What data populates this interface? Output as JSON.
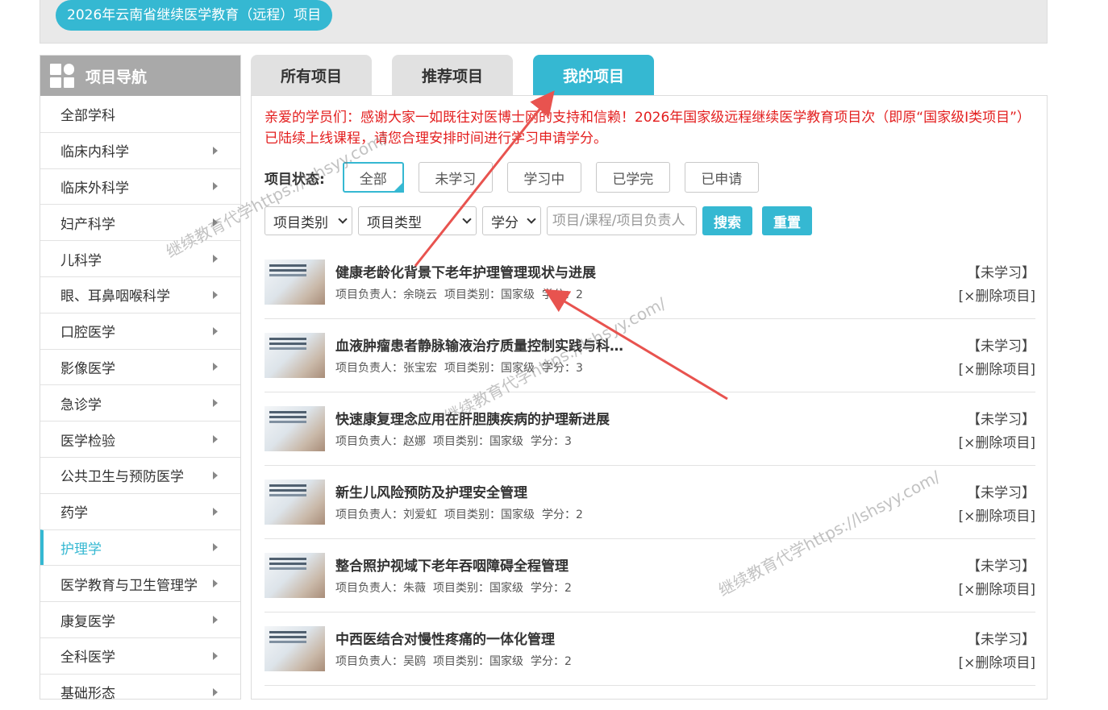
{
  "header": {
    "title": "2026年云南省继续医学教育（远程）项目"
  },
  "sidebar": {
    "title": "项目导航",
    "items": [
      {
        "label": "全部学科",
        "arrow": false
      },
      {
        "label": "临床内科学",
        "arrow": true
      },
      {
        "label": "临床外科学",
        "arrow": true
      },
      {
        "label": "妇产科学",
        "arrow": true
      },
      {
        "label": "儿科学",
        "arrow": true
      },
      {
        "label": "眼、耳鼻咽喉科学",
        "arrow": true
      },
      {
        "label": "口腔医学",
        "arrow": true
      },
      {
        "label": "影像医学",
        "arrow": true
      },
      {
        "label": "急诊学",
        "arrow": true
      },
      {
        "label": "医学检验",
        "arrow": true
      },
      {
        "label": "公共卫生与预防医学",
        "arrow": true
      },
      {
        "label": "药学",
        "arrow": true
      },
      {
        "label": "护理学",
        "arrow": true,
        "active": true
      },
      {
        "label": "医学教育与卫生管理学",
        "arrow": true
      },
      {
        "label": "康复医学",
        "arrow": true
      },
      {
        "label": "全科医学",
        "arrow": true
      },
      {
        "label": "基础形态",
        "arrow": true
      }
    ]
  },
  "tabs": [
    {
      "label": "所有项目"
    },
    {
      "label": "推荐项目"
    },
    {
      "label": "我的项目",
      "active": true
    }
  ],
  "notice": "亲爱的学员们：感谢大家一如既往对医博士网的支持和信赖！2026年国家级远程继续医学教育项目次（即原“国家级Ⅰ类项目”）已陆续上线课程，请您合理安排时间进行学习申请学分。",
  "status_filter": {
    "label": "项目状态:",
    "options": [
      "全部",
      "未学习",
      "学习中",
      "已学完",
      "已申请"
    ],
    "selected": 0
  },
  "filters": {
    "category": "项目类别",
    "type": "项目类型",
    "credit": "学分",
    "search_placeholder": "项目/课程/项目负责人",
    "search_btn": "搜索",
    "reset_btn": "重置"
  },
  "meta_labels": {
    "leader": "项目负责人：",
    "category": "项目类别：",
    "credit": "学分："
  },
  "projects": [
    {
      "title": "健康老龄化背景下老年护理管理现状与进展",
      "leader": "余晓云",
      "category": "国家级",
      "credit": "2",
      "status": "【未学习】",
      "delete": "[×删除项目]"
    },
    {
      "title": "血液肿瘤患者静脉输液治疗质量控制实践与科…",
      "leader": "张宝宏",
      "category": "国家级",
      "credit": "3",
      "status": "【未学习】",
      "delete": "[×删除项目]"
    },
    {
      "title": "快速康复理念应用在肝胆胰疾病的护理新进展",
      "leader": "赵娜",
      "category": "国家级",
      "credit": "3",
      "status": "【未学习】",
      "delete": "[×删除项目]"
    },
    {
      "title": "新生儿风险预防及护理安全管理",
      "leader": "刘爱虹",
      "category": "国家级",
      "credit": "2",
      "status": "【未学习】",
      "delete": "[×删除项目]"
    },
    {
      "title": "整合照护视域下老年吞咽障碍全程管理",
      "leader": "朱薇",
      "category": "国家级",
      "credit": "2",
      "status": "【未学习】",
      "delete": "[×删除项目]"
    },
    {
      "title": "中西医结合对慢性疼痛的一体化管理",
      "leader": "吴鸥",
      "category": "国家级",
      "credit": "2",
      "status": "【未学习】",
      "delete": "[×删除项目]"
    }
  ],
  "watermarks": [
    "继续教育代学https://lshsyy.com/",
    "继续教育代学https://lshsyy.com/",
    "继续教育代学https://lshsyy.com/"
  ],
  "colors": {
    "accent": "#35b8d2",
    "notice": "#e31e1e",
    "arrow": "#e8534f"
  }
}
